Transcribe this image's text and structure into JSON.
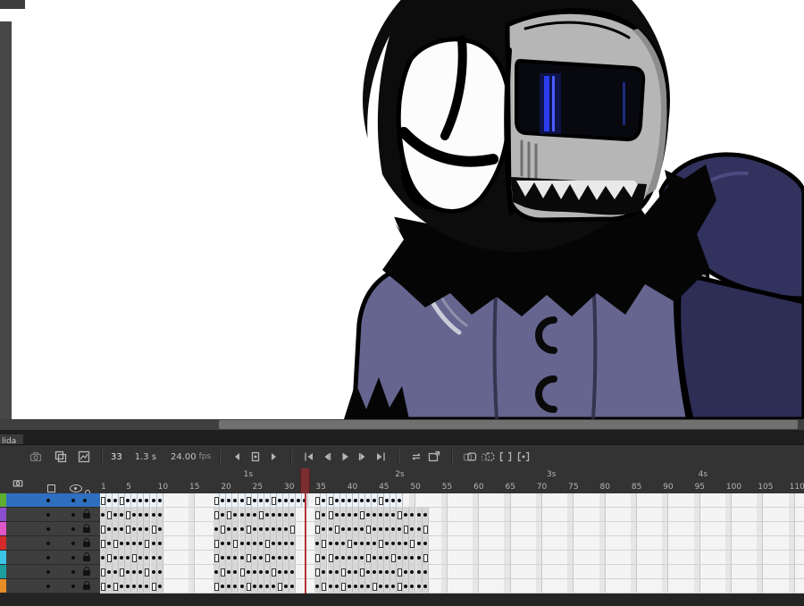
{
  "output_tab": {
    "label": "lida"
  },
  "toolbar": {
    "current_frame": "33",
    "elapsed_time": "1.3 s",
    "frame_rate": "24.00",
    "fps_unit": "fps"
  },
  "ruler": {
    "seconds": [
      {
        "label": "1s",
        "frame": 24
      },
      {
        "label": "2s",
        "frame": 48
      },
      {
        "label": "3s",
        "frame": 72
      },
      {
        "label": "4s",
        "frame": 96
      }
    ],
    "frames": [
      1,
      5,
      10,
      15,
      20,
      25,
      30,
      35,
      40,
      45,
      50,
      55,
      60,
      65,
      70,
      75,
      80,
      85,
      90,
      95,
      100,
      105,
      110
    ]
  },
  "playhead": {
    "frame": 33
  },
  "colors": {
    "selection_blue": "#2e6fbf",
    "playhead_red": "#b23537",
    "panel_dark": "#333333",
    "grid_light": "#f4f4f4"
  },
  "icons": {
    "toolbar": [
      "camera-icon",
      "layer-stack-icon",
      "frame-graph-icon",
      "step-back-one-icon",
      "center-frame-icon",
      "step-forward-one-icon",
      "go-to-first-frame-icon",
      "previous-frame-icon",
      "play-icon",
      "next-frame-icon",
      "go-to-last-frame-icon",
      "loop-playback-icon",
      "test-render-icon",
      "onion-skin-icon",
      "onion-skin-outlines-icon",
      "edit-multiple-frames-icon",
      "modify-markers-icon"
    ],
    "layer_header": [
      "camera-column-icon",
      "outline-column-icon",
      "visibility-column-icon",
      "lock-column-icon"
    ]
  },
  "layers": [
    {
      "color": "#5fae31",
      "selected": true,
      "locked": false,
      "segments": [
        {
          "start": 1,
          "cells": "bkkbkkkkkk"
        },
        {
          "start": 19,
          "cells": "bkkkkbkkkbkkkkk"
        },
        {
          "start": 35,
          "cells": "bkbkkkkkkkbkkk"
        }
      ]
    },
    {
      "color": "#8d4fd1",
      "selected": false,
      "locked": true,
      "segments": [
        {
          "start": 1,
          "cells": "kbkkbkkkkk"
        },
        {
          "start": 19,
          "cells": "bkbkkkkbkkkkk"
        },
        {
          "start": 35,
          "cells": "bkbkkkkbkkkkkbkkkk"
        }
      ]
    },
    {
      "color": "#e055c8",
      "selected": false,
      "locked": true,
      "segments": [
        {
          "start": 1,
          "cells": "bkkkbkkkbk"
        },
        {
          "start": 19,
          "cells": "kbkkkbkkkkkkb"
        },
        {
          "start": 35,
          "cells": "bkkbkkkkbkkkkkbkkb"
        }
      ]
    },
    {
      "color": "#d42a2a",
      "selected": false,
      "locked": true,
      "segments": [
        {
          "start": 1,
          "cells": "bkbkkkkbkk"
        },
        {
          "start": 19,
          "cells": "bkkbkkkkbkkkk"
        },
        {
          "start": 35,
          "cells": "kbkkkbkkkkbkkkkbkk"
        }
      ]
    },
    {
      "color": "#3bc3e8",
      "selected": false,
      "locked": true,
      "segments": [
        {
          "start": 1,
          "cells": "kbkkkbkkkk"
        },
        {
          "start": 19,
          "cells": "bkkkkbkkbkkkk"
        },
        {
          "start": 35,
          "cells": "bkbkkkkkbkkkbkkkkb"
        }
      ]
    },
    {
      "color": "#1d9d9d",
      "selected": false,
      "locked": true,
      "segments": [
        {
          "start": 1,
          "cells": "bkkbkkkbkk"
        },
        {
          "start": 19,
          "cells": "kbkkbkkkkbkkk"
        },
        {
          "start": 35,
          "cells": "bkkkbkkbkkkkkbkkkk"
        }
      ]
    },
    {
      "color": "#e88c28",
      "selected": false,
      "locked": true,
      "segments": [
        {
          "start": 1,
          "cells": "bkbkkkkkbk"
        },
        {
          "start": 19,
          "cells": "bkkkkbkkkkbkk"
        },
        {
          "start": 35,
          "cells": "kbkkbkkkkbkkkbkkkk"
        }
      ]
    }
  ]
}
